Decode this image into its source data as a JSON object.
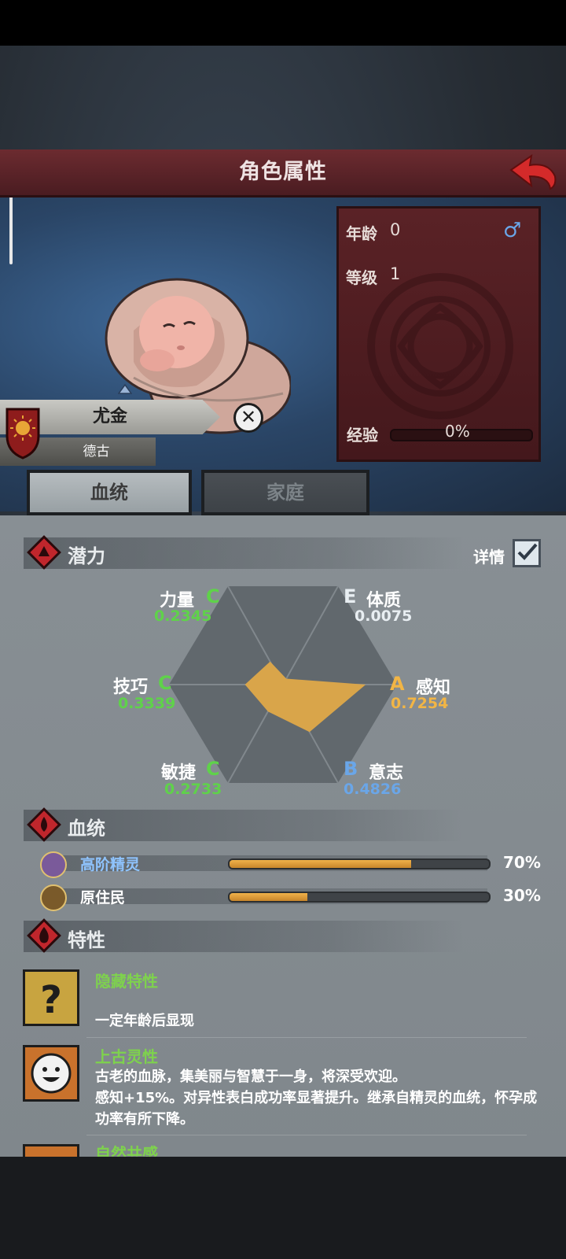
{
  "header": {
    "title": "角色属性"
  },
  "character": {
    "name": "尤金",
    "clan": "德古",
    "gender_symbol": "♂"
  },
  "stats": {
    "age_label": "年龄",
    "age_value": "0",
    "level_label": "等级",
    "level_value": "1",
    "exp_label": "经验",
    "exp_value": "0%"
  },
  "tabs": [
    {
      "label": "血统",
      "active": true
    },
    {
      "label": "家庭",
      "active": false
    }
  ],
  "potential": {
    "title": "潜力",
    "detail_label": "详情",
    "detail_checked": true,
    "attributes": [
      {
        "name": "力量",
        "grade": "C",
        "value": "0.2345",
        "grade_color": "#5fd24a"
      },
      {
        "name": "体质",
        "grade": "E",
        "value": "0.0075",
        "grade_color": "#e8eef2"
      },
      {
        "name": "感知",
        "grade": "A",
        "value": "0.7254",
        "grade_color": "#f2b545"
      },
      {
        "name": "意志",
        "grade": "B",
        "value": "0.4826",
        "grade_color": "#6aa6e8"
      },
      {
        "name": "敏捷",
        "grade": "C",
        "value": "0.2733",
        "grade_color": "#5fd24a"
      },
      {
        "name": "技巧",
        "grade": "C",
        "value": "0.3339",
        "grade_color": "#5fd24a"
      }
    ]
  },
  "chart_data": {
    "type": "radar",
    "categories": [
      "力量",
      "体质",
      "感知",
      "意志",
      "敏捷",
      "技巧"
    ],
    "values": [
      0.2345,
      0.0075,
      0.7254,
      0.4826,
      0.2733,
      0.3339
    ],
    "range": [
      0,
      1
    ],
    "fill_color": "#d9a54a"
  },
  "bloodline": {
    "title": "血统",
    "items": [
      {
        "name": "高阶精灵",
        "percent_label": "70%",
        "fraction": 0.7,
        "name_color": "#8fc4ff",
        "icon": "elf-icon"
      },
      {
        "name": "原住民",
        "percent_label": "30%",
        "fraction": 0.3,
        "name_color": "#ffffff",
        "icon": "leaf-icon"
      }
    ]
  },
  "traits": {
    "title": "特性",
    "items": [
      {
        "name": "隐藏特性",
        "desc": "一定年龄后显现",
        "icon": "question-icon"
      },
      {
        "name": "上古灵性",
        "desc_line1": "古老的血脉，集美丽与智慧于一身，将深受欢迎。",
        "desc_line2": "感知+15%。对异性表白成功率显著提升。继承自精灵的血统，怀孕成",
        "desc_line3": "功率有所下降。",
        "icon": "smiley-icon"
      },
      {
        "name": "自然共感",
        "icon": "smiley-icon"
      }
    ]
  }
}
